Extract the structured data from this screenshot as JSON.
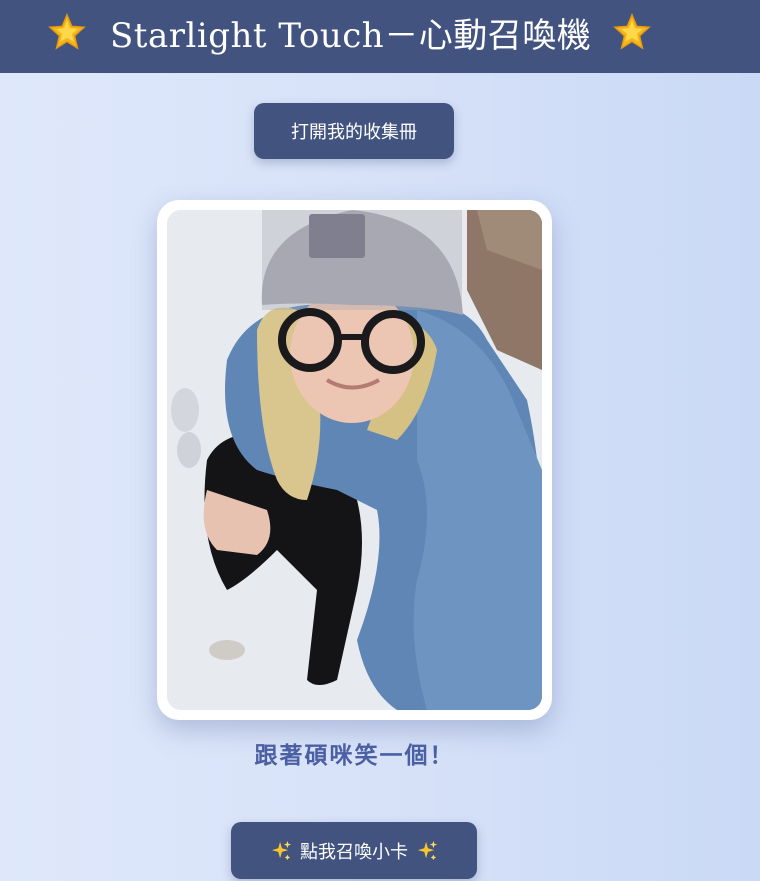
{
  "header": {
    "title": "Starlight Touch－心動召喚機",
    "left_icon": "glowing-star-emoji",
    "right_icon": "glowing-star-emoji"
  },
  "collection_button": {
    "label": "打開我的收集冊"
  },
  "card": {
    "photo_description_icon": "photo-card-image"
  },
  "caption": "跟著碩咪笑一個！",
  "summon_button": {
    "label": "點我召喚小卡",
    "icon": "sparkles-emoji"
  },
  "colors": {
    "header_bg": "#41537e",
    "button_bg": "#41537e",
    "caption_text": "#4b5fa3",
    "page_bg": "#d6e1f8"
  }
}
